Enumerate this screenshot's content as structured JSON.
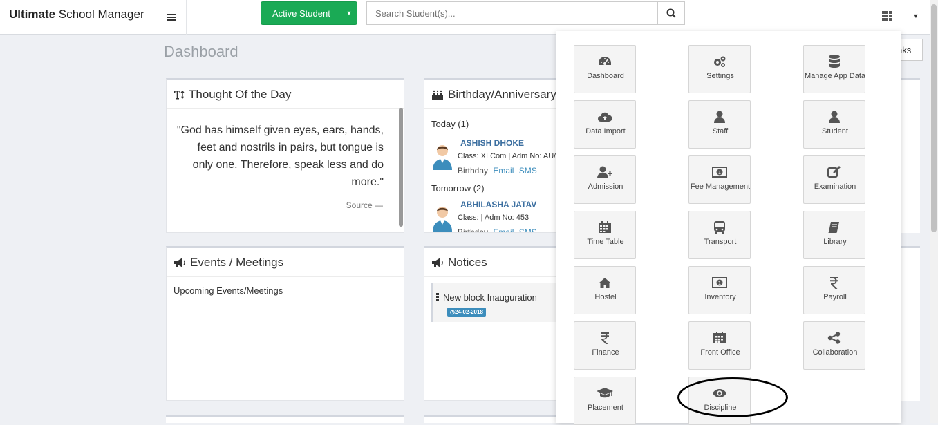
{
  "brand": {
    "bold": "Ultimate",
    "rest": " School Manager"
  },
  "header": {
    "active_student": "Active Student",
    "search_placeholder": "Search Student(s)..."
  },
  "page": {
    "title": "Dashboard",
    "links_btn": "nks"
  },
  "thought": {
    "title": "Thought Of the Day",
    "quote": "\"God has himself given eyes, ears, hands, feet and nostrils in pairs, but tongue is only one. Therefore, speak less and do more.\"",
    "source": "Source —"
  },
  "birthday": {
    "title": "Birthday/Anniversary",
    "today_label": "Today (1)",
    "tomorrow_label": "Tomorrow (2)",
    "people": [
      {
        "name": "ASHISH DHOKE",
        "class": "Class: XI Com | Adm No: AU/",
        "type": "Birthday",
        "email": "Email",
        "sms": "SMS"
      },
      {
        "name": "ABHILASHA JATAV",
        "class": "Class: | Adm No: 453",
        "type": "Birthday",
        "email": "Email",
        "sms": "SMS"
      }
    ]
  },
  "events": {
    "title": "Events / Meetings",
    "subtitle": "Upcoming Events/Meetings"
  },
  "notices": {
    "title": "Notices",
    "item_title": "New block Inauguration",
    "item_date": "24-02-2018"
  },
  "apps": [
    {
      "label": "Dashboard",
      "icon": "dashboard-icon"
    },
    {
      "label": "Settings",
      "icon": "gears-icon"
    },
    {
      "label": "Manage App Data",
      "icon": "database-icon"
    },
    {
      "label": "Data Import",
      "icon": "cloud-upload-icon"
    },
    {
      "label": "Staff",
      "icon": "user-icon"
    },
    {
      "label": "Student",
      "icon": "user-icon"
    },
    {
      "label": "Admission",
      "icon": "user-plus-icon"
    },
    {
      "label": "Fee Management",
      "icon": "money-icon"
    },
    {
      "label": "Examination",
      "icon": "edit-icon"
    },
    {
      "label": "Time Table",
      "icon": "calendar-icon"
    },
    {
      "label": "Transport",
      "icon": "bus-icon"
    },
    {
      "label": "Library",
      "icon": "book-icon"
    },
    {
      "label": "Hostel",
      "icon": "home-icon"
    },
    {
      "label": "Inventory",
      "icon": "money-icon"
    },
    {
      "label": "Payroll",
      "icon": "rupee-icon"
    },
    {
      "label": "Finance",
      "icon": "rupee-icon"
    },
    {
      "label": "Front Office",
      "icon": "calendar-icon"
    },
    {
      "label": "Collaboration",
      "icon": "share-icon"
    },
    {
      "label": "Placement",
      "icon": "graduation-cap-icon"
    },
    {
      "label": "Discipline",
      "icon": "eye-icon"
    }
  ]
}
